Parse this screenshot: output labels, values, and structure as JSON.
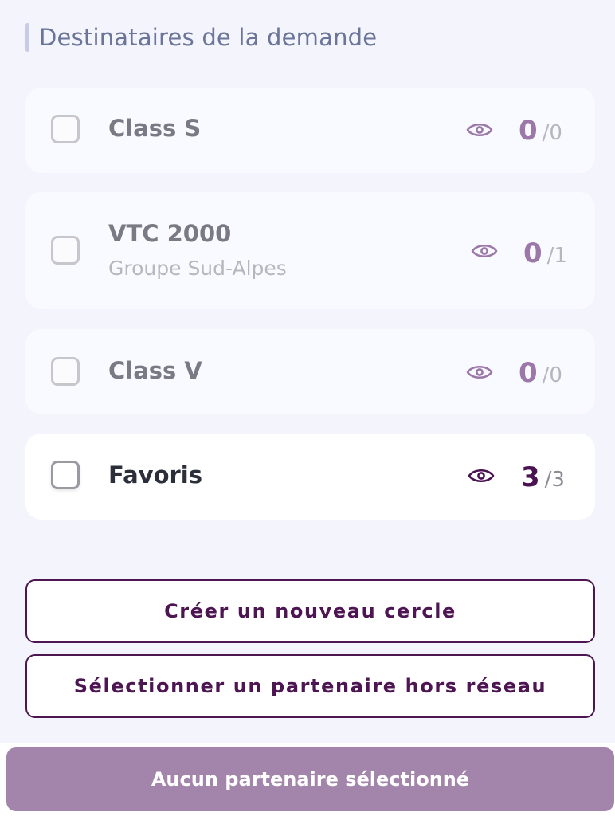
{
  "section": {
    "title": "Destinataires de la demande"
  },
  "groups": [
    {
      "name": "Class S",
      "subtitle": "",
      "selected": "0",
      "total": "/0",
      "checked": false
    },
    {
      "name": "VTC 2000",
      "subtitle": "Groupe Sud-Alpes",
      "selected": "0",
      "total": "/1",
      "checked": false
    },
    {
      "name": "Class V",
      "subtitle": "",
      "selected": "0",
      "total": "/0",
      "checked": false
    },
    {
      "name": "Favoris",
      "subtitle": "",
      "selected": "3",
      "total": "/3",
      "checked": false
    }
  ],
  "actions": {
    "create_circle": "Créer un nouveau cercle",
    "select_outside_partner": "Sélectionner un partenaire hors réseau"
  },
  "footer": {
    "submit_label": "Aucun partenaire sélectionné"
  },
  "icons": {
    "view": "eye-icon"
  },
  "colors": {
    "accent": "#4d1552",
    "disabled_button": "#a384ab",
    "muted_count": "#9b78a8",
    "background": "#f3f4fc"
  }
}
